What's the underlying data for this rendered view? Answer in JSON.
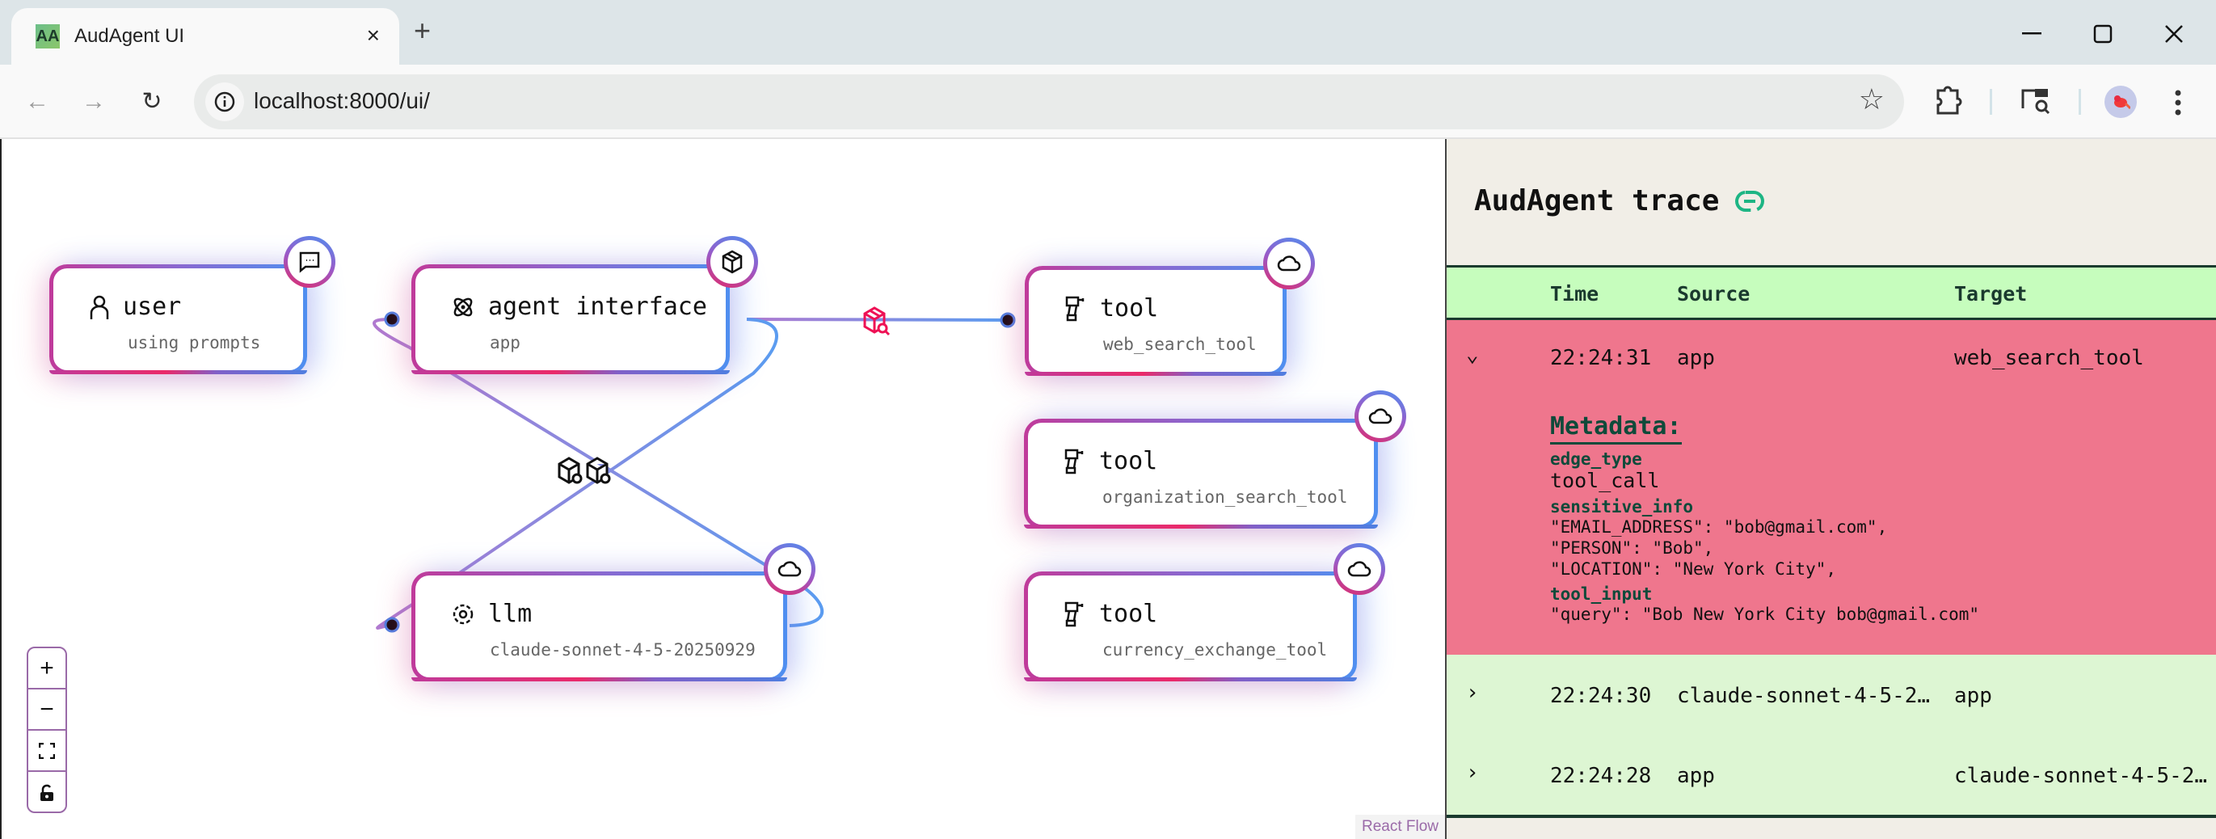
{
  "browser": {
    "tab_title": "AudAgent UI",
    "favicon_text": "AA",
    "url": "localhost:8000/ui/",
    "new_tab_label": "+",
    "close_tab_label": "×"
  },
  "graph": {
    "nodes": [
      {
        "title": "user",
        "subtitle": "using prompts",
        "icon": "user-icon",
        "badge": "chat-icon"
      },
      {
        "title": "agent interface",
        "subtitle": "app",
        "icon": "atom-icon",
        "badge": "box-icon"
      },
      {
        "title": "llm",
        "subtitle": "claude-sonnet-4-5-20250929",
        "icon": "gear-icon",
        "badge": "cloud-icon"
      },
      {
        "title": "tool",
        "subtitle": "web_search_tool",
        "icon": "drill-icon",
        "badge": "cloud-icon"
      },
      {
        "title": "tool",
        "subtitle": "organization_search_tool",
        "icon": "drill-icon",
        "badge": "cloud-icon"
      },
      {
        "title": "tool",
        "subtitle": "currency_exchange_tool",
        "icon": "drill-icon",
        "badge": "cloud-icon"
      }
    ],
    "highlight_color": "#ee1155",
    "controls": {
      "zoom_in": "+",
      "zoom_out": "−"
    },
    "attribution": "React Flow"
  },
  "trace": {
    "title": "AudAgent trace",
    "columns": {
      "time": "Time",
      "source": "Source",
      "target": "Target"
    },
    "rows": [
      {
        "time": "22:24:31",
        "source": "app",
        "target": "web_search_tool",
        "expanded": true,
        "flagged": true,
        "metadata": {
          "heading": "Metadata:",
          "edge_type_key": "edge_type",
          "edge_type": "tool_call",
          "sensitive_info_key": "sensitive_info",
          "sensitive_info": [
            "\"EMAIL_ADDRESS\": \"bob@gmail.com\",",
            "\"PERSON\": \"Bob\",",
            "\"LOCATION\": \"New York City\","
          ],
          "tool_input_key": "tool_input",
          "tool_input": "\"query\": \"Bob New York City bob@gmail.com\""
        }
      },
      {
        "time": "22:24:30",
        "source": "claude-sonnet-4-5-2…",
        "target": "app",
        "expanded": false
      },
      {
        "time": "22:24:28",
        "source": "app",
        "target": "claude-sonnet-4-5-2…",
        "expanded": false
      }
    ],
    "colors": {
      "flagged_row": "#ef768d",
      "normal_row": "#ddf6d3",
      "header": "#c6fdbd",
      "link_icon": "#1db584"
    }
  }
}
